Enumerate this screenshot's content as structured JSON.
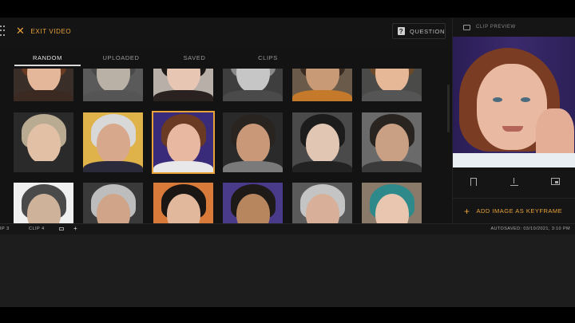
{
  "header": {
    "exit_label": "EXIT VIDEO",
    "question_label": "QUESTION"
  },
  "tabs": [
    {
      "label": "RANDOM",
      "active": true
    },
    {
      "label": "UPLOADED",
      "active": false
    },
    {
      "label": "SAVED",
      "active": false
    },
    {
      "label": "CLIPS",
      "active": false
    }
  ],
  "preview": {
    "title": "CLIP PREVIEW",
    "add_keyframe_label": "ADD IMAGE AS KEYFRAME"
  },
  "timeline": {
    "clip_prev_label": "IP 3",
    "clip_current_label": "CLIP 4",
    "autosave_text": "AUTOSAVED: 03/10/2021, 3:10 PM"
  },
  "colors": {
    "accent": "#e8a33a",
    "background": "#131313"
  },
  "thumbnails": [
    {
      "bg": "#3a2e28",
      "hair": "#6a3a22",
      "face": "#e5b79a",
      "shirt": "#3a2a22"
    },
    {
      "bg": "#5a5a5a",
      "hair": "#4a4a4a",
      "face": "#b9b0a6",
      "shirt": "#555"
    },
    {
      "bg": "#b8b0a8",
      "hair": "#1e1a18",
      "face": "#e8c6b4",
      "shirt": "#2a2220"
    },
    {
      "bg": "#3e3e3e",
      "hair": "#8a8a8a",
      "face": "#c6c6c6",
      "shirt": "#4a4a4a"
    },
    {
      "bg": "#6a5a4a",
      "hair": "#3a2c22",
      "face": "#c89a76",
      "shirt": "#c47a2a"
    },
    {
      "bg": "#4a4a48",
      "hair": "#6a4a2a",
      "face": "#e6b898",
      "shirt": "#555"
    },
    {
      "bg": "#2a2a2a",
      "hair": "#b9aa92",
      "face": "#e2c0a6",
      "shirt": "#2a2a2a"
    },
    {
      "bg": "#e0b24a",
      "hair": "#d8d8d8",
      "face": "#d8a88c",
      "shirt": "#2a2a3a"
    },
    {
      "bg": "#3a2a7a",
      "hair": "#6a3a22",
      "face": "#e8b8a0",
      "shirt": "#e8e8ea"
    },
    {
      "bg": "#2a2a2a",
      "hair": "#2a2420",
      "face": "#c89878",
      "shirt": "#7a7a7a"
    },
    {
      "bg": "#4a4a4a",
      "hair": "#1c1c1c",
      "face": "#e2c6b4",
      "shirt": "#222"
    },
    {
      "bg": "#6a6a6a",
      "hair": "#2a2420",
      "face": "#caa084",
      "shirt": "#3a3a3a"
    },
    {
      "bg": "#f0f0f0",
      "hair": "#4a4a4a",
      "face": "#cfb29a",
      "shirt": "#333"
    },
    {
      "bg": "#3a3a3a",
      "hair": "#bdbdbd",
      "face": "#d0a488",
      "shirt": "#2a2a3a"
    },
    {
      "bg": "#d87a3a",
      "hair": "#1a1614",
      "face": "#e2b89c",
      "shirt": "#222"
    },
    {
      "bg": "#4a3a8a",
      "hair": "#1e1a18",
      "face": "#b8865e",
      "shirt": "#c44040"
    },
    {
      "bg": "#5a5a5a",
      "hair": "#c4c4c4",
      "face": "#d8b09a",
      "shirt": "#333"
    },
    {
      "bg": "#8a7a6a",
      "hair": "#2e8a8a",
      "face": "#e8c6b0",
      "shirt": "#444"
    }
  ]
}
